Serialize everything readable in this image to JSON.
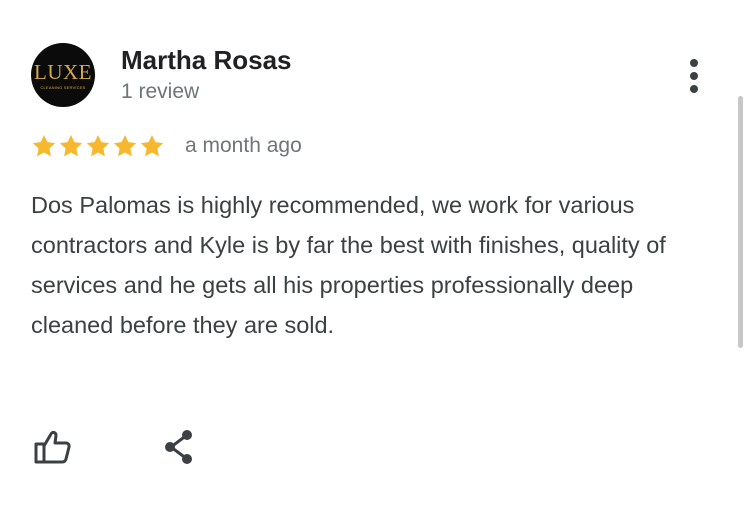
{
  "reviewer": {
    "name": "Martha Rosas",
    "review_count": "1 review",
    "avatar_logo": "LUXE",
    "avatar_subtitle": "CLEANING SERVICES"
  },
  "review": {
    "rating": 5,
    "rating_max": 5,
    "time": "a month ago",
    "text": "Dos Palomas is highly recommended, we work for various contractors and Kyle is by far the best with finishes, quality of services and he gets all his properties professionally deep cleaned before they are sold."
  },
  "icons": {
    "more": "more-vert-icon",
    "like": "thumb-up-icon",
    "share": "share-icon",
    "star": "star-icon"
  },
  "colors": {
    "star": "#f5b82e",
    "avatar_bg": "#0b0b0b",
    "avatar_logo": "#d4a94a",
    "name": "#202124",
    "secondary_text": "#70757a",
    "body_text": "#3c4043",
    "icon": "#3c4043"
  }
}
